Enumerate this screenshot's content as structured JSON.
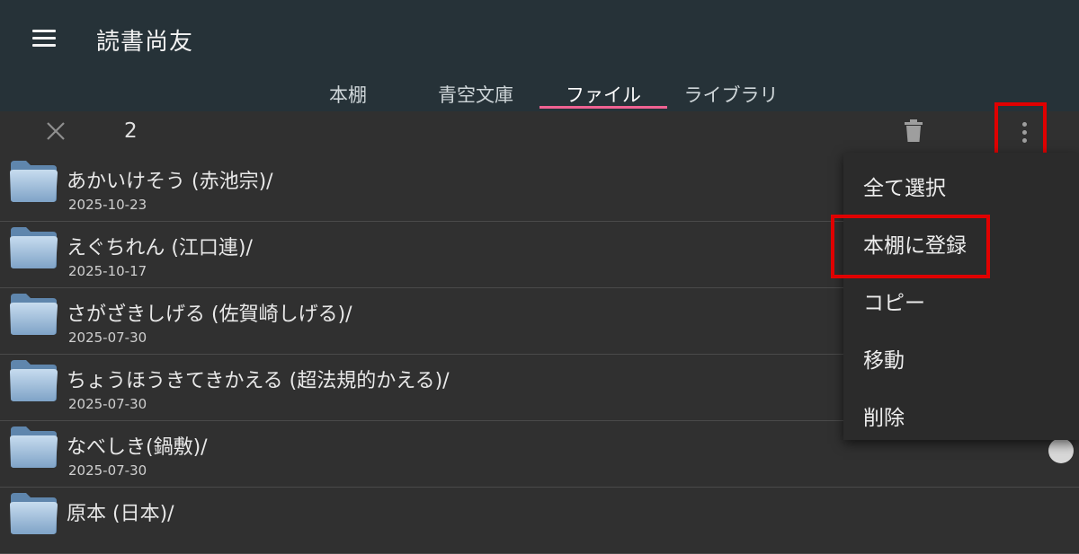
{
  "app": {
    "title": "読書尚友"
  },
  "tabs": [
    {
      "label": "本棚",
      "active": false
    },
    {
      "label": "青空文庫",
      "active": false
    },
    {
      "label": "ファイル",
      "active": true
    },
    {
      "label": "ライブラリ",
      "active": false
    }
  ],
  "action_bar": {
    "selected_count": "2"
  },
  "files": [
    {
      "name": "あかいけそう (赤池宗)/",
      "date": "2025-10-23"
    },
    {
      "name": "えぐちれん (江口連)/",
      "date": "2025-10-17"
    },
    {
      "name": "さがざきしげる (佐賀崎しげる)/",
      "date": "2025-07-30"
    },
    {
      "name": "ちょうほうきてきかえる (超法規的かえる)/",
      "date": "2025-07-30"
    },
    {
      "name": "なべしき(鍋敷)/",
      "date": "2025-07-30"
    },
    {
      "name": "原本 (日本)/",
      "date": ""
    }
  ],
  "popup_menu": {
    "items": [
      "全て選択",
      "本棚に登録",
      "コピー",
      "移動",
      "削除"
    ]
  },
  "colors": {
    "appbar": "#263238",
    "tab_indicator": "#f06292",
    "highlight": "#e00000",
    "background": "#303030"
  }
}
